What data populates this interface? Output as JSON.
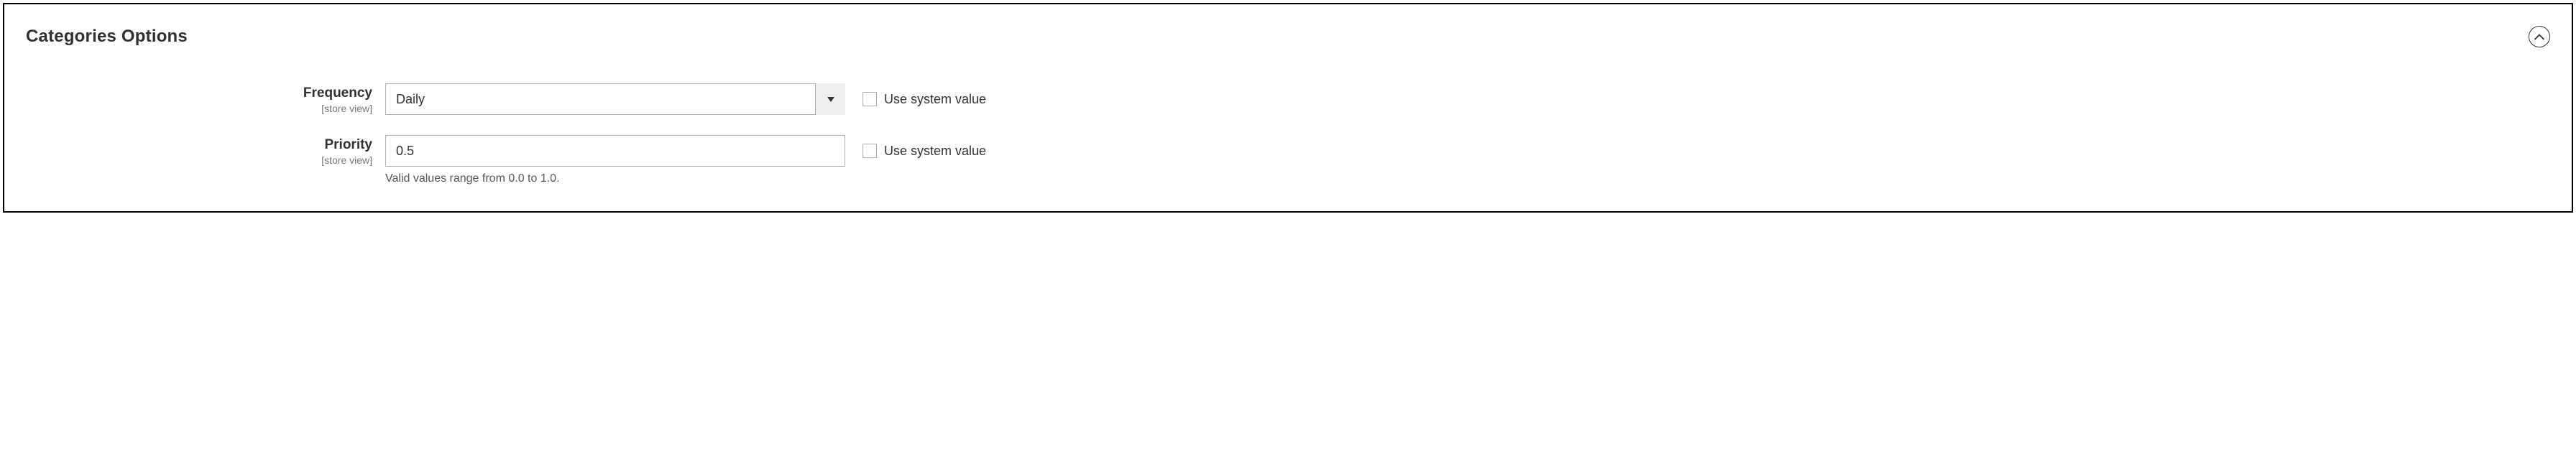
{
  "section": {
    "title": "Categories Options"
  },
  "fields": {
    "frequency": {
      "label": "Frequency",
      "scope": "[store view]",
      "value": "Daily",
      "use_system_label": "Use system value"
    },
    "priority": {
      "label": "Priority",
      "scope": "[store view]",
      "value": "0.5",
      "hint": "Valid values range from 0.0 to 1.0.",
      "use_system_label": "Use system value"
    }
  }
}
